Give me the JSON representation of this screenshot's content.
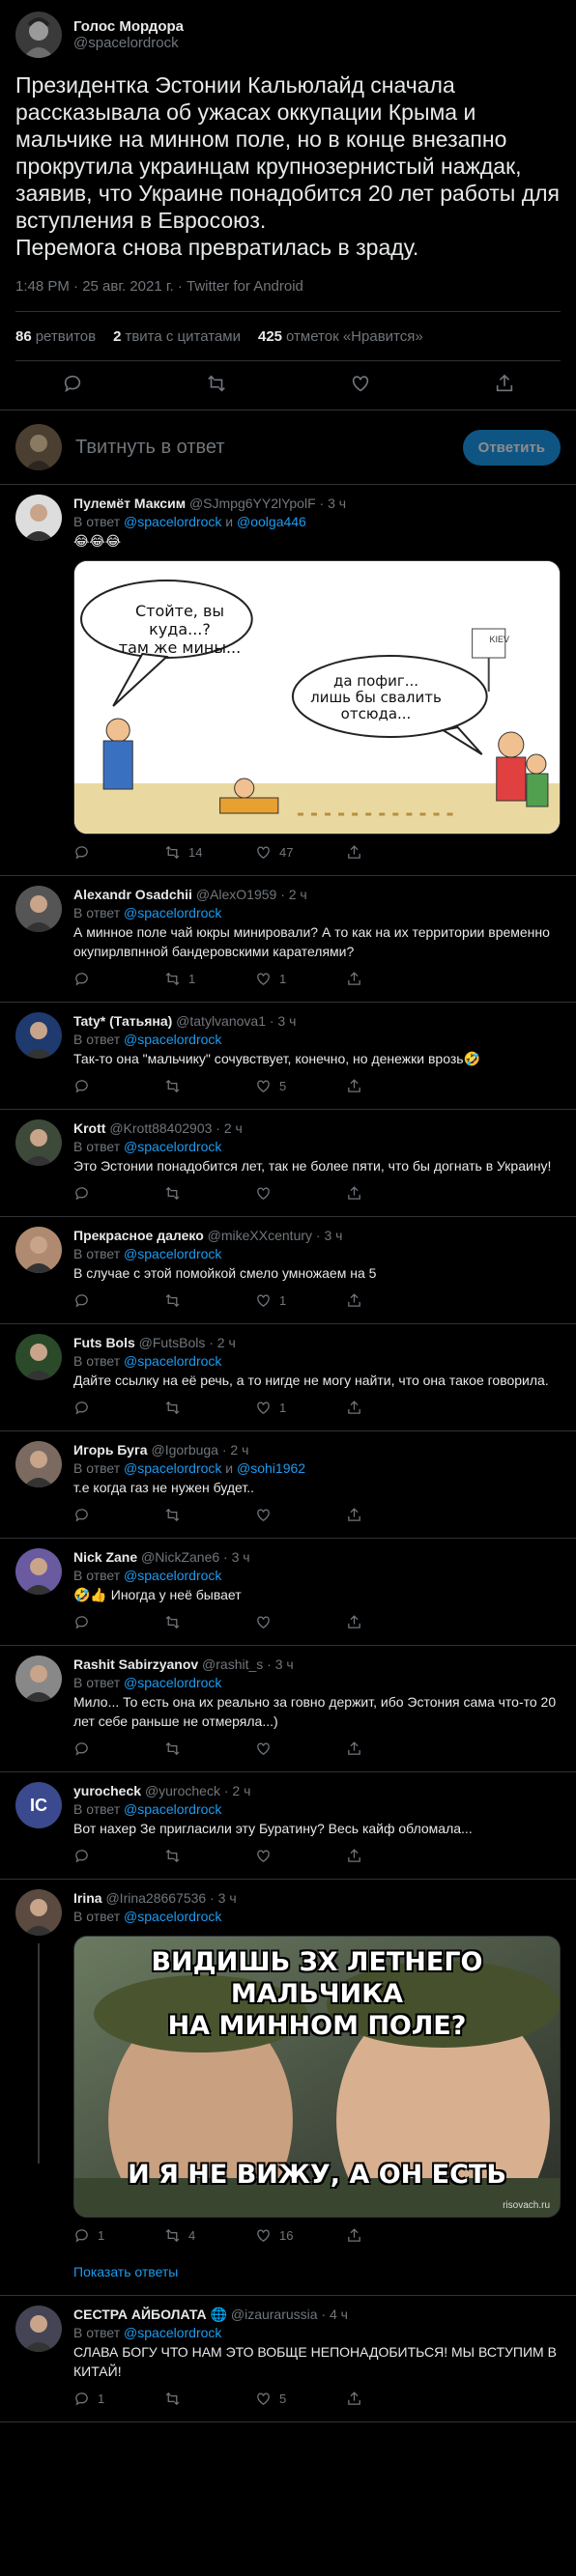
{
  "main_tweet": {
    "author_name": "Голос Мордора",
    "author_handle": "@spacelordrock",
    "text": "Президентка Эстонии Кальюлайд сначала рассказывала об ужасах оккупации Крыма и мальчике на минном поле, но в конце внезапно прокрутила украинцам крупнозернистый наждак, заявив, что Украине понадобится 20 лет работы для вступления в Евросоюз.\nПеремога снова превратилась в зраду.",
    "meta": "1:48 PM · 25 авг. 2021 г. · Twitter for Android",
    "stats": {
      "retweets_num": "86",
      "retweets_label": "ретвитов",
      "quotes_num": "2",
      "quotes_label": "твита с цитатами",
      "likes_num": "425",
      "likes_label": "отметок «Нравится»"
    }
  },
  "reply_box": {
    "placeholder": "Твитнуть в ответ",
    "button": "Ответить"
  },
  "replies": [
    {
      "name": "Пулемёт Максим",
      "handle": "@SJmpg6YY2lYpolF · 3 ч",
      "to_prefix": "В ответ",
      "to": "@spacelordrock",
      "to_and": "и",
      "to2": "@oolga446",
      "text": "😂😂😂",
      "reply": "",
      "retweet": "14",
      "like": "47",
      "comic": {
        "left": "Стойте, вы куда...?\nтам же мины...",
        "right": "да пофиг...\nлишь бы свалить\nотсюда...",
        "sign": "KIEV"
      }
    },
    {
      "name": "Alexandr Osadchii",
      "handle": "@AlexO1959 · 2 ч",
      "to_prefix": "В ответ",
      "to": "@spacelordrock",
      "text": "А минное поле чай юкры минировали? А то как на их территории временно окупирлвпнной бандеровскими карателями?",
      "reply": "",
      "retweet": "1",
      "like": "1"
    },
    {
      "name": "Taty* (Татьяна)",
      "handle": "@tatylvanova1 · 3 ч",
      "to_prefix": "В ответ",
      "to": "@spacelordrock",
      "text": "Так-то она \"мальчику\" сочувствует, конечно, но денежки врозь🤣",
      "reply": "",
      "retweet": "",
      "like": "5"
    },
    {
      "name": "Krott",
      "handle": "@Krott88402903 · 2 ч",
      "to_prefix": "В ответ",
      "to": "@spacelordrock",
      "text": "Это Эстонии понадобится лет, так не более пяти, что бы догнать в Украину!",
      "reply": "",
      "retweet": "",
      "like": ""
    },
    {
      "name": "Прекрасное далеко",
      "handle": "@mikeXXcentury · 3 ч",
      "to_prefix": "В ответ",
      "to": "@spacelordrock",
      "text": "В случае с этой помойкой смело умножаем на 5",
      "reply": "",
      "retweet": "",
      "like": "1"
    },
    {
      "name": "Futs Bols",
      "handle": "@FutsBols · 2 ч",
      "to_prefix": "В ответ",
      "to": "@spacelordrock",
      "text": "Дайте ссылку на её речь, а то нигде не могу найти, что она такое говорила.",
      "reply": "",
      "retweet": "",
      "like": "1"
    },
    {
      "name": "Игорь Буга",
      "handle": "@Igorbuga · 2 ч",
      "to_prefix": "В ответ",
      "to": "@spacelordrock",
      "to_and": "и",
      "to2": "@sohi1962",
      "text": "т.е когда газ не нужен будет..",
      "reply": "",
      "retweet": "",
      "like": ""
    },
    {
      "name": "Nick Zane",
      "handle": "@NickZane6 · 3 ч",
      "to_prefix": "В ответ",
      "to": "@spacelordrock",
      "text": "🤣👍 Иногда у неё бывает",
      "reply": "",
      "retweet": "",
      "like": ""
    },
    {
      "name": "Rashit Sabirzyanov",
      "handle": "@rashit_s · 3 ч",
      "to_prefix": "В ответ",
      "to": "@spacelordrock",
      "text": "Мило... То есть она их реально за говно держит, ибо Эстония сама что-то 20 лет себе раньше не отмеряла...)",
      "reply": "",
      "retweet": "",
      "like": ""
    },
    {
      "name": "yurocheck",
      "handle": "@yurocheck · 2 ч",
      "to_prefix": "В ответ",
      "to": "@spacelordrock",
      "text": "Вот нахер Зе пригласили эту Буратину? Весь кайф обломала...",
      "reply": "",
      "retweet": "",
      "like": "",
      "avatar_text": "IC"
    },
    {
      "name": "Irina",
      "handle": "@Irina28667536 · 3 ч",
      "to_prefix": "В ответ",
      "to": "@spacelordrock",
      "text": "",
      "reply": "1",
      "retweet": "4",
      "like": "16",
      "meme": {
        "top": "ВИДИШЬ ЗХ ЛЕТНЕГО МАЛЬЧИКА\nНА МИННОМ ПОЛЕ?",
        "bottom": "И Я НЕ ВИЖУ, А ОН ЕСТЬ",
        "mark": "risovach.ru"
      }
    },
    {
      "name": "СЕСТРА АЙБОЛАТА 🌐",
      "handle": "@izaurarussia · 4 ч",
      "to_prefix": "В ответ",
      "to": "@spacelordrock",
      "text": "СЛАВА БОГУ ЧТО НАМ ЭТО ВОБЩЕ НЕПОНАДОБИТЬСЯ! МЫ ВСТУПИМ В КИТАЙ!",
      "reply": "1",
      "retweet": "",
      "like": "5"
    }
  ],
  "show_replies": "Показать ответы"
}
